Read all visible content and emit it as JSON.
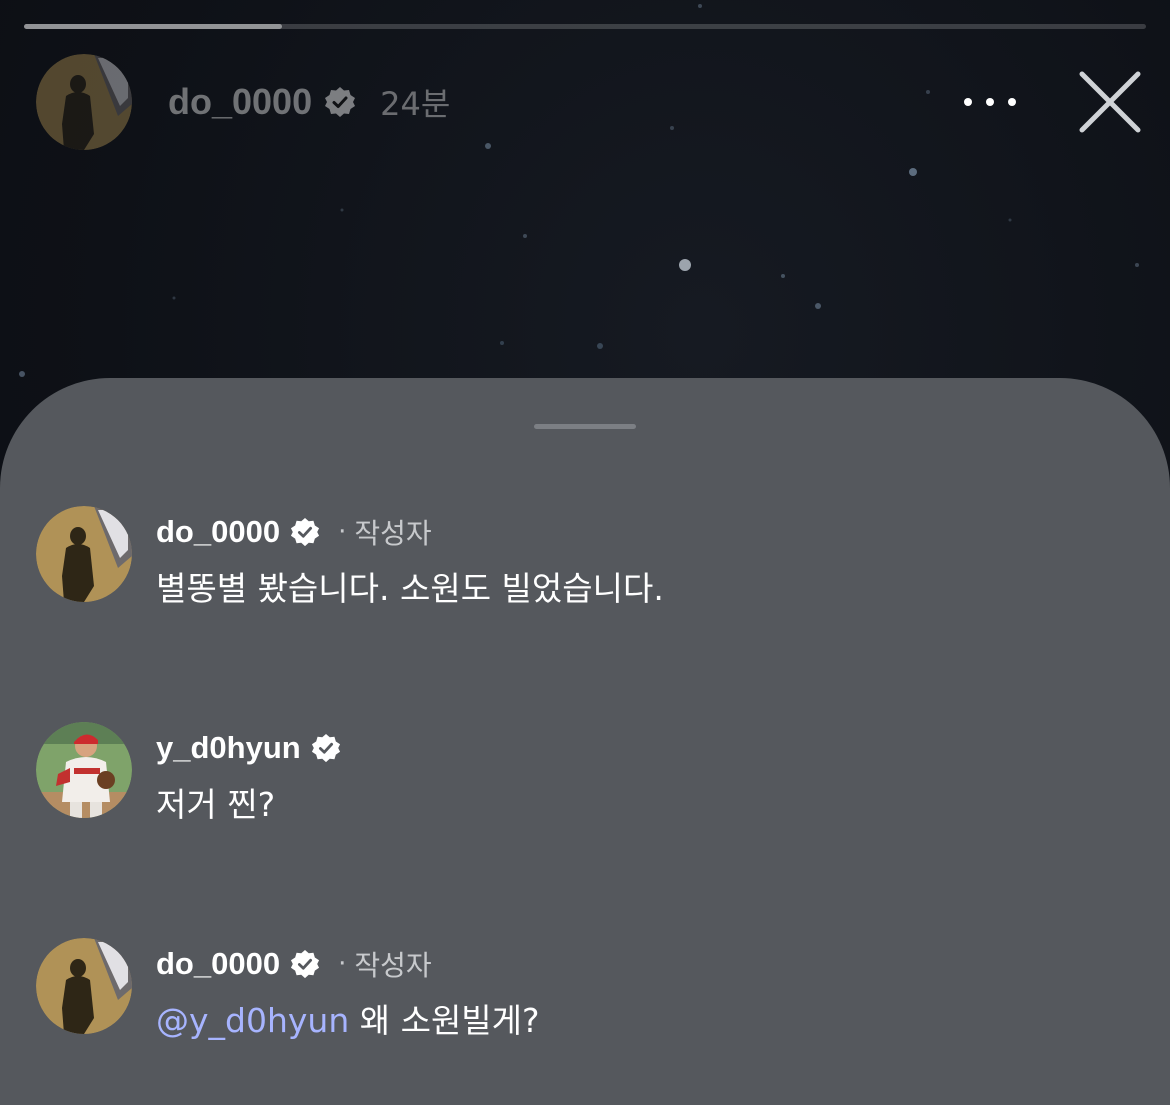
{
  "story": {
    "username": "do_0000",
    "time": "24분",
    "progress": 0.23,
    "icons": {
      "verified": "verified-badge-icon",
      "more": "more-horizontal-icon",
      "close": "close-icon"
    }
  },
  "comments": [
    {
      "username": "do_0000",
      "separator": "·",
      "author_label": "작성자",
      "text": "별똥별 봤습니다. 소원도 빌었습니다."
    },
    {
      "username": "y_d0hyun",
      "text": "저거 찐?"
    },
    {
      "username": "do_0000",
      "separator": "·",
      "author_label": "작성자",
      "mention": "@y_d0hyun",
      "text": " 왜 소원빌게?"
    }
  ],
  "colors": {
    "sheet": "#55585d",
    "mention": "#a7b4ff",
    "background": "#0e1117"
  }
}
